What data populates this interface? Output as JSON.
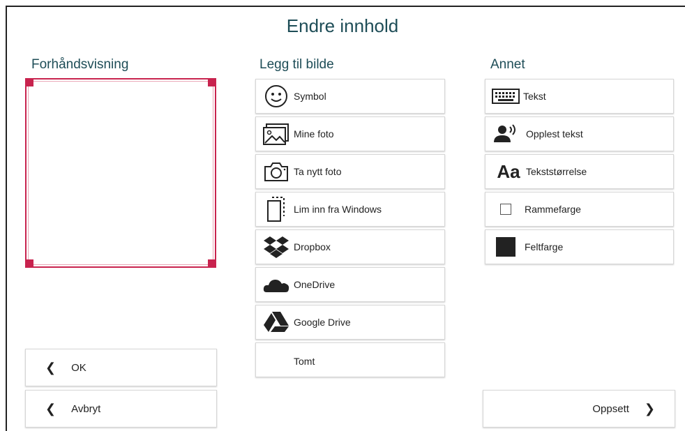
{
  "dialog": {
    "title": "Endre innhold"
  },
  "sections": {
    "preview": "Forhåndsvisning",
    "add_image": "Legg til bilde",
    "other": "Annet"
  },
  "add_image_items": [
    {
      "label": "Symbol",
      "icon": "smiley-icon"
    },
    {
      "label": "Mine foto",
      "icon": "photos-icon"
    },
    {
      "label": "Ta nytt foto",
      "icon": "camera-icon"
    },
    {
      "label": "Lim inn fra Windows",
      "icon": "paste-icon"
    },
    {
      "label": "Dropbox",
      "icon": "dropbox-icon"
    },
    {
      "label": "OneDrive",
      "icon": "onedrive-icon"
    },
    {
      "label": "Google Drive",
      "icon": "google-drive-icon"
    },
    {
      "label": "Tomt",
      "icon": ""
    }
  ],
  "other_items": [
    {
      "label": "Tekst",
      "icon": "keyboard-icon"
    },
    {
      "label": "Opplest tekst",
      "icon": "speaker-person-icon"
    },
    {
      "label": "Tekststørrelse",
      "icon": "text-size-icon",
      "icon_text": "Aa"
    },
    {
      "label": "Rammefarge",
      "icon": "frame-color-swatch",
      "color": "#ffffff"
    },
    {
      "label": "Feltfarge",
      "icon": "fill-color-swatch",
      "color": "#222222"
    }
  ],
  "footer": {
    "ok": "OK",
    "cancel": "Avbryt",
    "setup": "Oppsett"
  },
  "colors": {
    "title": "#1e4d57",
    "selection": "#c8234e"
  }
}
